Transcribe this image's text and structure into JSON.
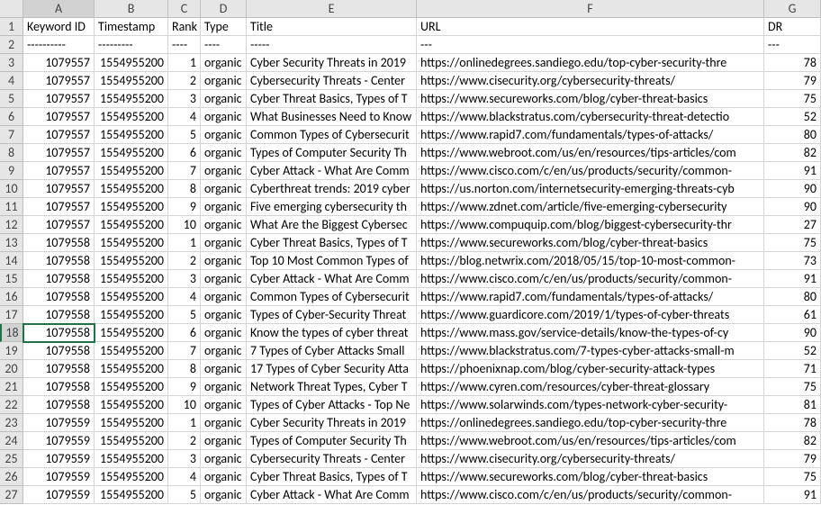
{
  "columns": [
    "A",
    "B",
    "C",
    "D",
    "E",
    "F",
    "G"
  ],
  "rownums": [
    1,
    2,
    3,
    4,
    5,
    6,
    7,
    8,
    9,
    10,
    11,
    12,
    13,
    14,
    15,
    16,
    17,
    18,
    19,
    20,
    21,
    22,
    23,
    24,
    25,
    26,
    27
  ],
  "selected": {
    "row": 18,
    "col": "A"
  },
  "header": {
    "A": "Keyword ID",
    "B": "Timestamp",
    "C": "Rank",
    "D": "Type",
    "E": "Title",
    "F": "URL",
    "G": "DR"
  },
  "divider": {
    "A": "----------",
    "B": "---------",
    "C": "----",
    "D": "----",
    "E": "-----",
    "F": "---",
    "G": "---"
  },
  "rows": [
    {
      "kid": "1079557",
      "ts": "1554955200",
      "rank": "1",
      "type": "organic",
      "title": "Cyber Security Threats in 2019",
      "url": "https://onlinedegrees.sandiego.edu/top-cyber-security-thre",
      "dr": "78"
    },
    {
      "kid": "1079557",
      "ts": "1554955200",
      "rank": "2",
      "type": "organic",
      "title": "Cybersecurity Threats - Center",
      "url": "https://www.cisecurity.org/cybersecurity-threats/",
      "dr": "79"
    },
    {
      "kid": "1079557",
      "ts": "1554955200",
      "rank": "3",
      "type": "organic",
      "title": "Cyber Threat Basics, Types of T",
      "url": "https://www.secureworks.com/blog/cyber-threat-basics",
      "dr": "75"
    },
    {
      "kid": "1079557",
      "ts": "1554955200",
      "rank": "4",
      "type": "organic",
      "title": "What Businesses Need to Know",
      "url": "https://www.blackstratus.com/cybersecurity-threat-detectio",
      "dr": "52"
    },
    {
      "kid": "1079557",
      "ts": "1554955200",
      "rank": "5",
      "type": "organic",
      "title": "Common Types of Cybersecurit",
      "url": "https://www.rapid7.com/fundamentals/types-of-attacks/",
      "dr": "80"
    },
    {
      "kid": "1079557",
      "ts": "1554955200",
      "rank": "6",
      "type": "organic",
      "title": "Types of Computer Security Th",
      "url": "https://www.webroot.com/us/en/resources/tips-articles/com",
      "dr": "82"
    },
    {
      "kid": "1079557",
      "ts": "1554955200",
      "rank": "7",
      "type": "organic",
      "title": "Cyber Attack - What Are Comm",
      "url": "https://www.cisco.com/c/en/us/products/security/common-",
      "dr": "91"
    },
    {
      "kid": "1079557",
      "ts": "1554955200",
      "rank": "8",
      "type": "organic",
      "title": "Cyberthreat trends: 2019 cyber",
      "url": "https://us.norton.com/internetsecurity-emerging-threats-cyb",
      "dr": "90"
    },
    {
      "kid": "1079557",
      "ts": "1554955200",
      "rank": "9",
      "type": "organic",
      "title": "Five emerging cybersecurity th",
      "url": "https://www.zdnet.com/article/five-emerging-cybersecurity",
      "dr": "90"
    },
    {
      "kid": "1079557",
      "ts": "1554955200",
      "rank": "10",
      "type": "organic",
      "title": "What Are the Biggest Cybersec",
      "url": "https://www.compuquip.com/blog/biggest-cybersecurity-thr",
      "dr": "27"
    },
    {
      "kid": "1079558",
      "ts": "1554955200",
      "rank": "1",
      "type": "organic",
      "title": "Cyber Threat Basics, Types of T",
      "url": "https://www.secureworks.com/blog/cyber-threat-basics",
      "dr": "75"
    },
    {
      "kid": "1079558",
      "ts": "1554955200",
      "rank": "2",
      "type": "organic",
      "title": "Top 10 Most Common Types of",
      "url": "https://blog.netwrix.com/2018/05/15/top-10-most-common-",
      "dr": "73"
    },
    {
      "kid": "1079558",
      "ts": "1554955200",
      "rank": "3",
      "type": "organic",
      "title": "Cyber Attack - What Are Comm",
      "url": "https://www.cisco.com/c/en/us/products/security/common-",
      "dr": "91"
    },
    {
      "kid": "1079558",
      "ts": "1554955200",
      "rank": "4",
      "type": "organic",
      "title": "Common Types of Cybersecurit",
      "url": "https://www.rapid7.com/fundamentals/types-of-attacks/",
      "dr": "80"
    },
    {
      "kid": "1079558",
      "ts": "1554955200",
      "rank": "5",
      "type": "organic",
      "title": "Types of Cyber-Security Threat",
      "url": "https://www.guardicore.com/2019/1/types-of-cyber-threats",
      "dr": "61"
    },
    {
      "kid": "1079558",
      "ts": "1554955200",
      "rank": "6",
      "type": "organic",
      "title": "Know the types of cyber threat",
      "url": "https://www.mass.gov/service-details/know-the-types-of-cy",
      "dr": "90"
    },
    {
      "kid": "1079558",
      "ts": "1554955200",
      "rank": "7",
      "type": "organic",
      "title": "7 Types of Cyber Attacks Small",
      "url": "https://www.blackstratus.com/7-types-cyber-attacks-small-m",
      "dr": "52"
    },
    {
      "kid": "1079558",
      "ts": "1554955200",
      "rank": "8",
      "type": "organic",
      "title": "17 Types of Cyber Security Atta",
      "url": "https://phoenixnap.com/blog/cyber-security-attack-types",
      "dr": "71"
    },
    {
      "kid": "1079558",
      "ts": "1554955200",
      "rank": "9",
      "type": "organic",
      "title": "Network Threat Types, Cyber T",
      "url": "https://www.cyren.com/resources/cyber-threat-glossary",
      "dr": "75"
    },
    {
      "kid": "1079558",
      "ts": "1554955200",
      "rank": "10",
      "type": "organic",
      "title": "Types of Cyber Attacks - Top Ne",
      "url": "https://www.solarwinds.com/types-network-cyber-security-",
      "dr": "81"
    },
    {
      "kid": "1079559",
      "ts": "1554955200",
      "rank": "1",
      "type": "organic",
      "title": "Cyber Security Threats in 2019",
      "url": "https://onlinedegrees.sandiego.edu/top-cyber-security-thre",
      "dr": "78"
    },
    {
      "kid": "1079559",
      "ts": "1554955200",
      "rank": "2",
      "type": "organic",
      "title": "Types of Computer Security Th",
      "url": "https://www.webroot.com/us/en/resources/tips-articles/com",
      "dr": "82"
    },
    {
      "kid": "1079559",
      "ts": "1554955200",
      "rank": "3",
      "type": "organic",
      "title": "Cybersecurity Threats - Center",
      "url": "https://www.cisecurity.org/cybersecurity-threats/",
      "dr": "79"
    },
    {
      "kid": "1079559",
      "ts": "1554955200",
      "rank": "4",
      "type": "organic",
      "title": "Cyber Threat Basics, Types of T",
      "url": "https://www.secureworks.com/blog/cyber-threat-basics",
      "dr": "75"
    },
    {
      "kid": "1079559",
      "ts": "1554955200",
      "rank": "5",
      "type": "organic",
      "title": "Cyber Attack - What Are Comm",
      "url": "https://www.cisco.com/c/en/us/products/security/common-",
      "dr": "91"
    }
  ]
}
